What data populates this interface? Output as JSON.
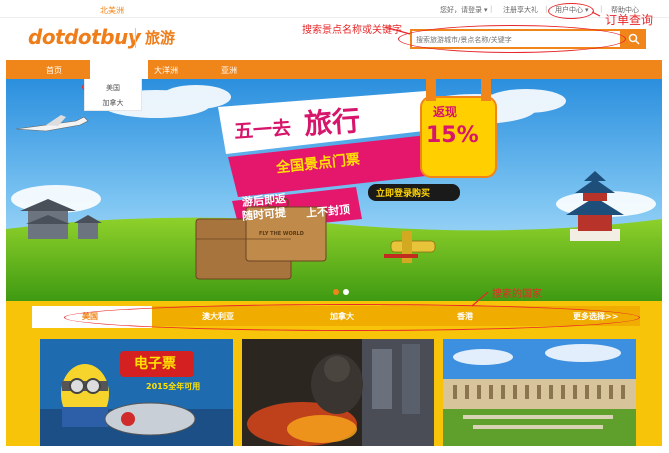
{
  "topbar": {
    "greeting": "您好，请登录",
    "greeting_arrow": "▾",
    "register": "注册享大礼",
    "user_center": "用户中心",
    "user_center_arrow": "▾",
    "help_center": "帮助中心"
  },
  "header": {
    "logo": "dotdotbuy",
    "site_section": "旅游",
    "search_placeholder": "搜索旅游城市/景点名称/关键字"
  },
  "nav": {
    "items": [
      "首页",
      "北美洲",
      "大洋洲",
      "亚洲"
    ],
    "active": "北美洲",
    "dropdown": [
      "美国",
      "加拿大"
    ]
  },
  "banner": {
    "headline_part1": "五一去",
    "headline_part2": "旅行",
    "subheadline": "全国景点门票",
    "slogan_line1": "游后即返",
    "slogan_line2": "随时可提",
    "slogan_line3": "上不封顶",
    "cta": "立即登录购买",
    "cashback_label": "返现",
    "cashback_value": "15%",
    "suitcase_text": "FLY THE WORLD"
  },
  "tabs": {
    "items": [
      "美国",
      "澳大利亚",
      "加拿大",
      "香港"
    ],
    "active": "美国",
    "more": "更多选择>>"
  },
  "cards": [
    {
      "badge": "电子票",
      "subtitle": "2015全年可用"
    },
    {
      "badge": "",
      "subtitle": ""
    },
    {
      "badge": "",
      "subtitle": ""
    }
  ],
  "annotations": {
    "search": "搜索景点名称或关键字",
    "order": "订单查询",
    "country": "搜索的国家"
  },
  "colors": {
    "brand_orange": "#f08519",
    "tab_yellow": "#f8c40a",
    "annotation_red": "#e8282a"
  }
}
